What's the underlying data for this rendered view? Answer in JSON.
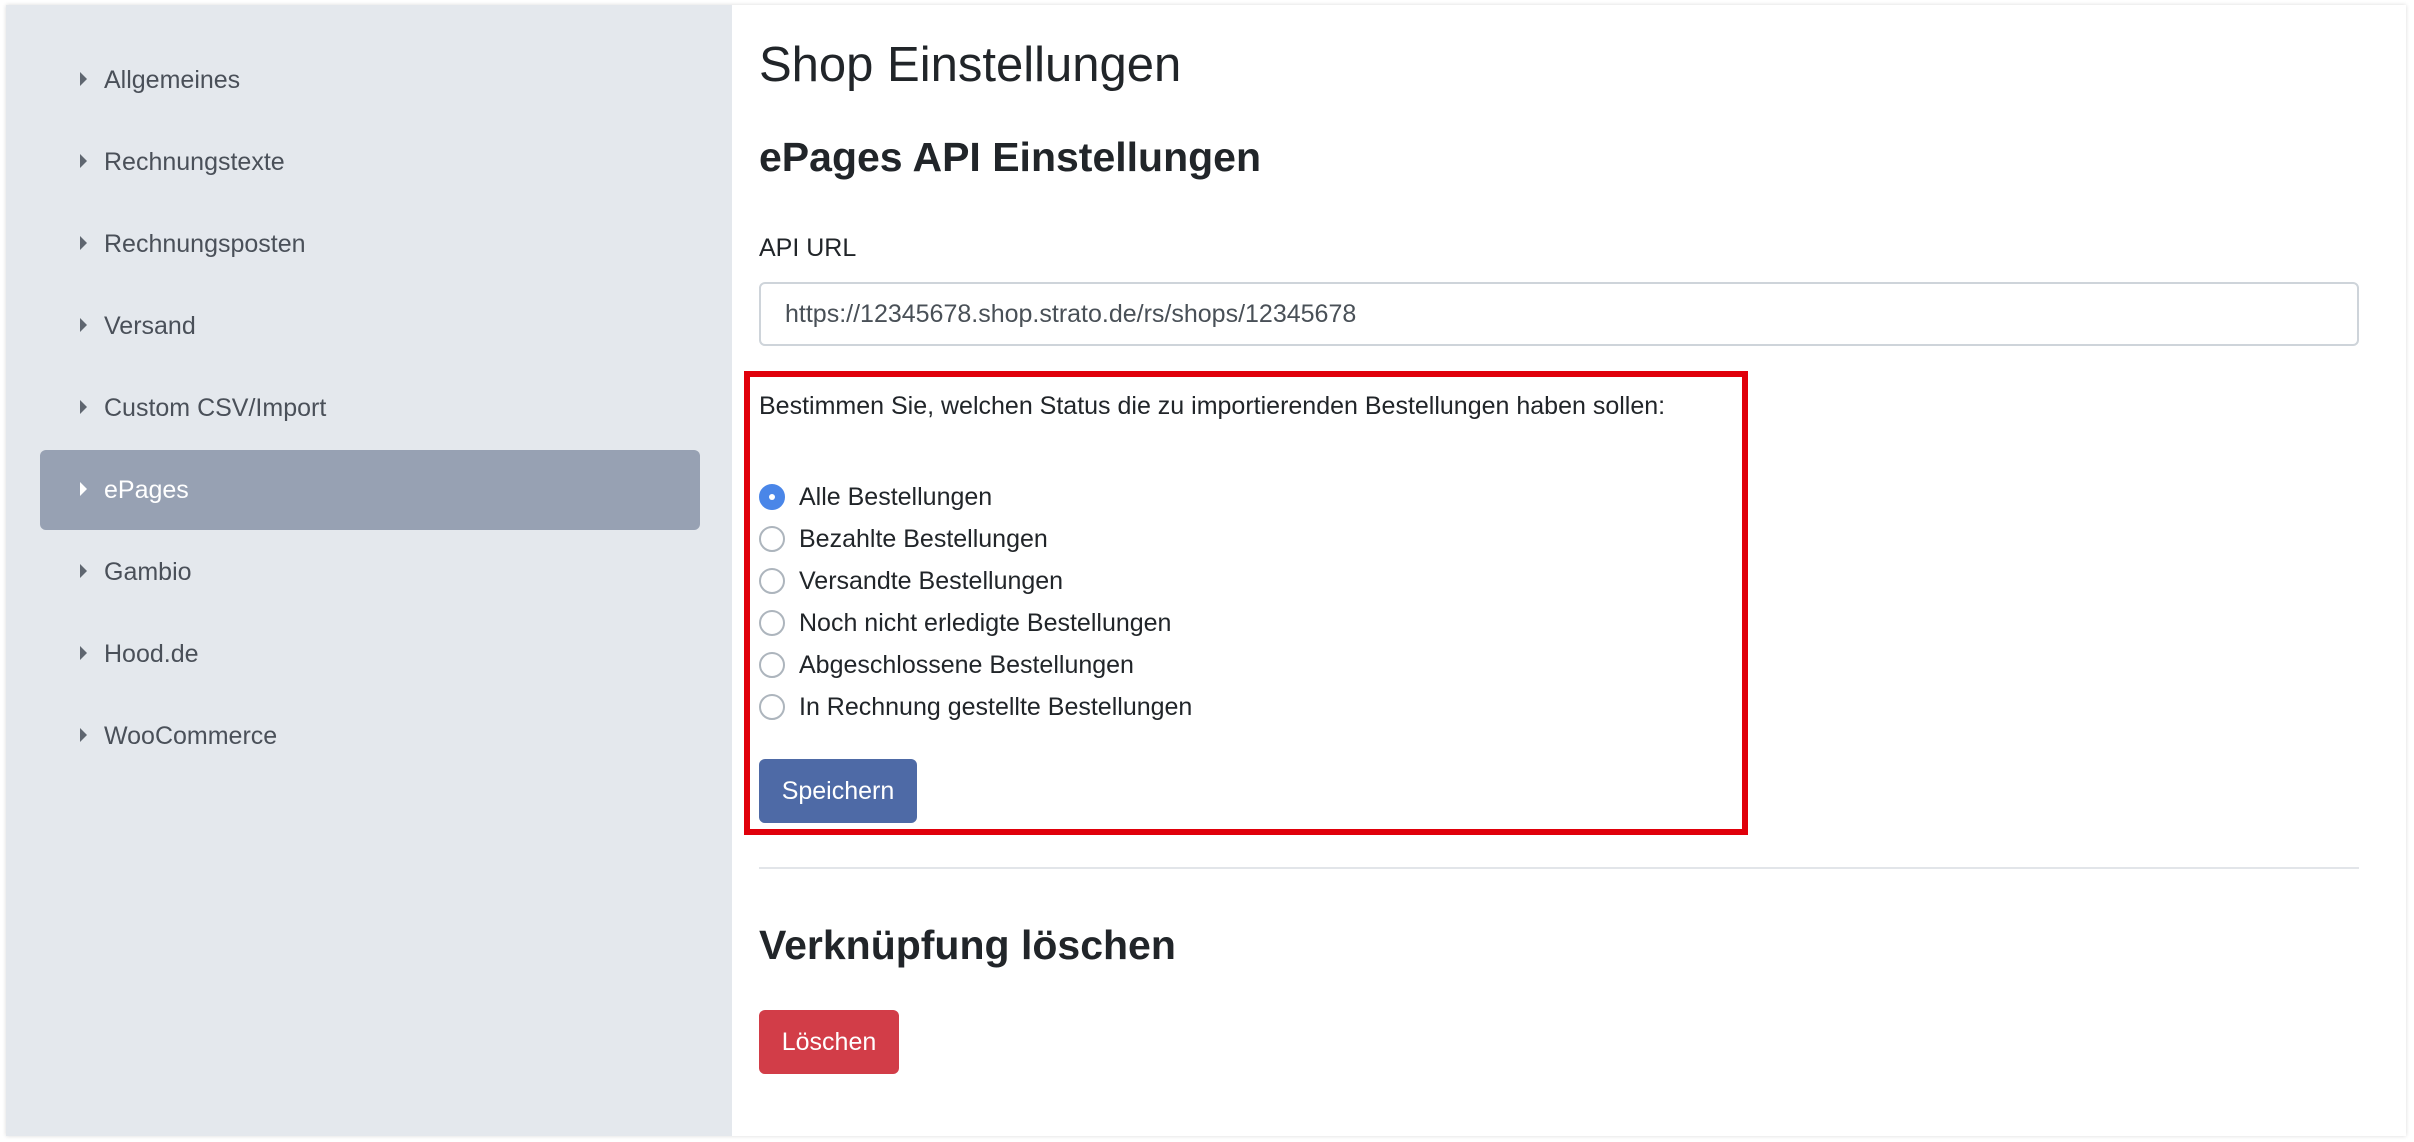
{
  "sidebar": {
    "items": [
      {
        "label": "Allgemeines",
        "active": false
      },
      {
        "label": "Rechnungstexte",
        "active": false
      },
      {
        "label": "Rechnungsposten",
        "active": false
      },
      {
        "label": "Versand",
        "active": false
      },
      {
        "label": "Custom CSV/Import",
        "active": false
      },
      {
        "label": "ePages",
        "active": true
      },
      {
        "label": "Gambio",
        "active": false
      },
      {
        "label": "Hood.de",
        "active": false
      },
      {
        "label": "WooCommerce",
        "active": false
      }
    ],
    "icon": "caret-right-icon"
  },
  "main": {
    "page_title": "Shop Einstellungen",
    "section_title": "ePages API Einstellungen",
    "api_url_label": "API URL",
    "api_url_value": "https://12345678.shop.strato.de/rs/shops/12345678",
    "status_question": "Bestimmen Sie, welchen Status die zu importierenden Bestellungen haben sollen:",
    "status_options": [
      {
        "label": "Alle Bestellungen",
        "checked": true
      },
      {
        "label": "Bezahlte Bestellungen",
        "checked": false
      },
      {
        "label": "Versandte Bestellungen",
        "checked": false
      },
      {
        "label": "Noch nicht erledigte Bestellungen",
        "checked": false
      },
      {
        "label": "Abgeschlossene Bestellungen",
        "checked": false
      },
      {
        "label": "In Rechnung gestellte Bestellungen",
        "checked": false
      }
    ],
    "save_label": "Speichern",
    "delete_section_title": "Verknüpfung löschen",
    "delete_label": "Löschen"
  },
  "colors": {
    "sidebar_bg": "#e4e8ed",
    "active_item_bg": "#97a1b3",
    "primary": "#4e6aa6",
    "danger": "#d23d48",
    "highlight": "#e0000b",
    "radio_checked": "#4a86e8"
  }
}
